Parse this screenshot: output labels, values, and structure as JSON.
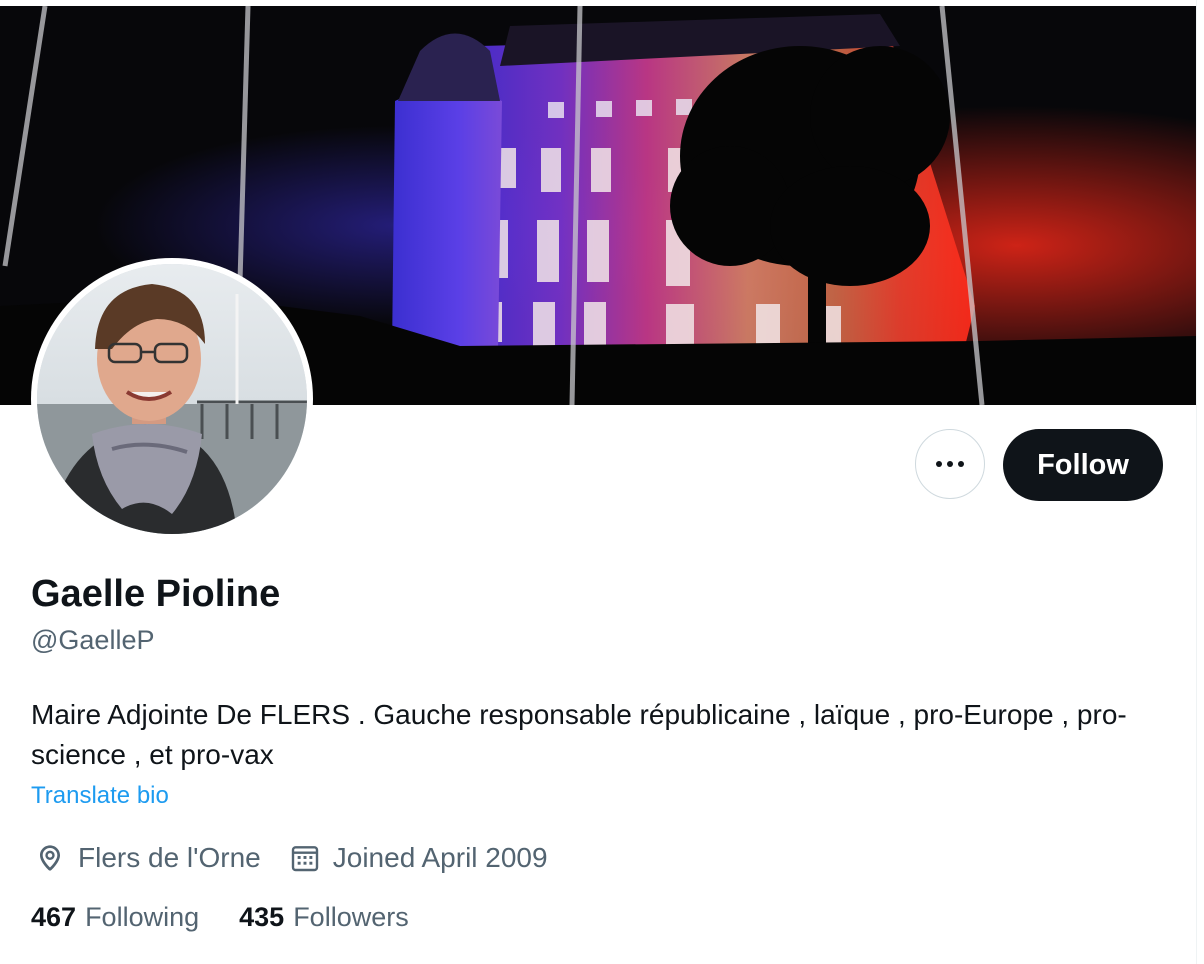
{
  "profile": {
    "display_name": "Gaelle Pioline",
    "handle": "@GaelleP",
    "bio": "Maire Adjointe De FLERS . Gauche responsable républicaine , laïque , pro-Europe , pro-science , et pro-vax",
    "translate_label": "Translate bio",
    "location": "Flers de l'Orne",
    "joined": "Joined April 2009"
  },
  "actions": {
    "follow_label": "Follow"
  },
  "stats": {
    "following_count": "467",
    "following_label": "Following",
    "followers_count": "435",
    "followers_label": "Followers"
  },
  "icons": {
    "more": "more-horizontal-icon",
    "location": "location-pin-icon",
    "calendar": "calendar-icon"
  },
  "colors": {
    "primary_text": "#0f1419",
    "secondary_text": "#536471",
    "link": "#1d9bf0",
    "follow_bg": "#0f1419",
    "follow_text": "#ffffff"
  }
}
